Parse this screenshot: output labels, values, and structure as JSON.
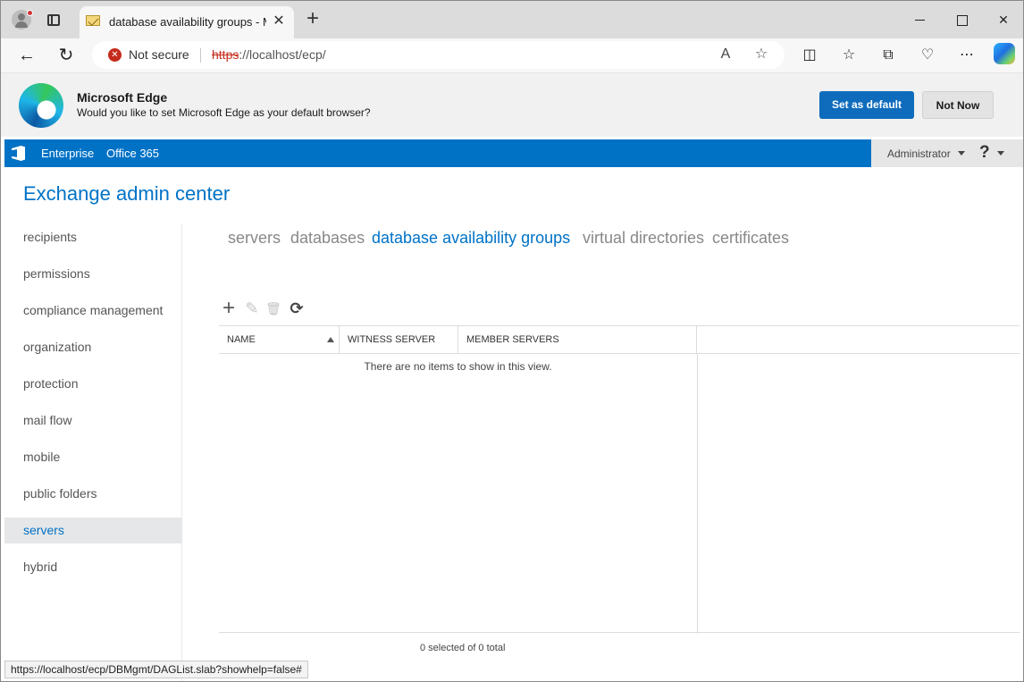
{
  "browser": {
    "tab_title": "database availability groups - Microsoft Edge",
    "tab_close": "✕",
    "new_tab": "+",
    "security_label": "Not secure",
    "url_scheme": "https",
    "url_rest": "://localhost/ecp/",
    "status_url": "https://localhost/ecp/DBMgmt/DAGList.slab?showhelp=false#",
    "icons": [
      "profile-icon",
      "tab-actions-icon",
      "back-icon",
      "refresh-icon",
      "read-aloud-icon",
      "favorite-icon",
      "split-screen-icon",
      "favorites-icon",
      "collections-icon",
      "browser-essentials-icon",
      "more-icon",
      "copilot-icon"
    ]
  },
  "infobar": {
    "title": "Microsoft Edge",
    "message": "Would you like to set Microsoft Edge as your default browser?",
    "primary_button": "Set as default",
    "secondary_button": "Not Now"
  },
  "topbar": {
    "links": [
      "Enterprise",
      "Office 365"
    ],
    "user": "Administrator",
    "help": "?"
  },
  "app": {
    "title": "Exchange admin center"
  },
  "nav": {
    "items": [
      "recipients",
      "permissions",
      "compliance management",
      "organization",
      "protection",
      "mail flow",
      "mobile",
      "public folders",
      "servers",
      "hybrid"
    ],
    "selected": "servers"
  },
  "subtabs": {
    "items": [
      "servers",
      "databases",
      "database availability groups",
      "virtual directories",
      "certificates"
    ],
    "selected": "database availability groups"
  },
  "toolbar": {
    "add": "+",
    "edit": "✎",
    "delete": "🗑",
    "refresh": "⟳"
  },
  "grid": {
    "columns": [
      "NAME",
      "WITNESS SERVER",
      "MEMBER SERVERS"
    ],
    "sort_column": "NAME",
    "empty_message": "There are no items to show in this view.",
    "count": "0 selected of 0 total"
  },
  "colors": {
    "accent": "#0072c6",
    "selected_nav_bg": "#e6e7e8",
    "edge_button": "#0f6cbd",
    "insecure": "#c42b1c"
  }
}
